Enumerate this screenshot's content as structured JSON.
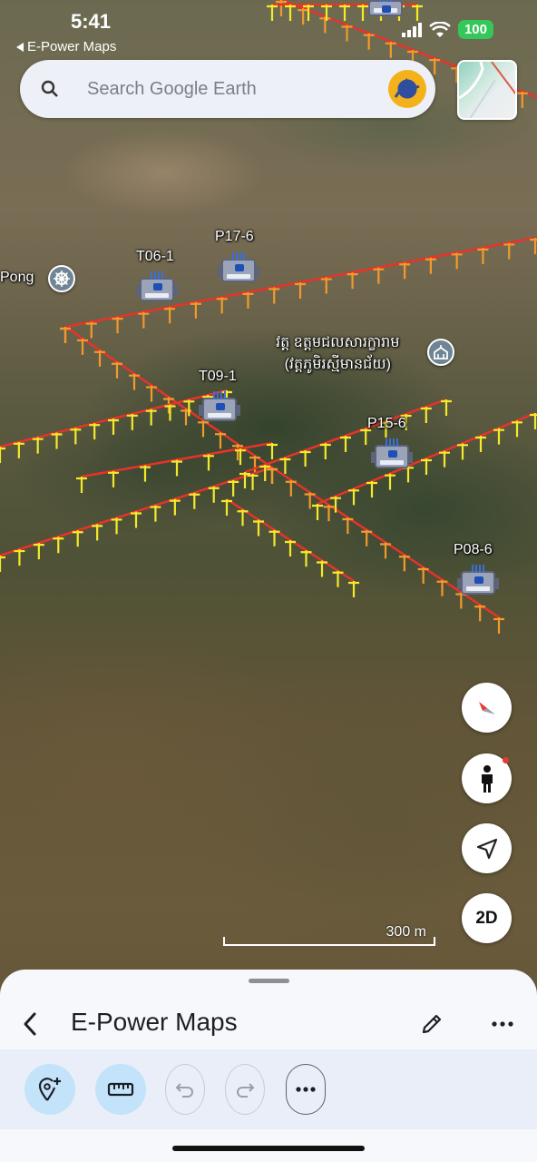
{
  "status_bar": {
    "time": "5:41",
    "back_app": "E-Power Maps",
    "battery": "100"
  },
  "search": {
    "placeholder": "Search Google Earth"
  },
  "map": {
    "poi_partial_label": "Pong",
    "temple_label_line1": "វត្ត ឧត្តមជលសារក្ខារាម",
    "temple_label_line2": "(វត្តភូមិរស្មីមានជ័យ)",
    "markers": [
      {
        "label": "T06-1"
      },
      {
        "label": "P17-6"
      },
      {
        "label": "T09-1"
      },
      {
        "label": "P15-6"
      },
      {
        "label": "P08-6"
      }
    ],
    "line_colors": {
      "primary": "#e8322a",
      "orange_pole": "#f39a2c",
      "yellow_pole": "#f4ea2a"
    },
    "scale_label": "300 m"
  },
  "controls": {
    "compass": "compass-icon",
    "street_view": "pegman-icon",
    "my_location": "navigation-arrow-icon",
    "view_mode_label": "2D"
  },
  "sheet": {
    "title": "E-Power Maps"
  }
}
